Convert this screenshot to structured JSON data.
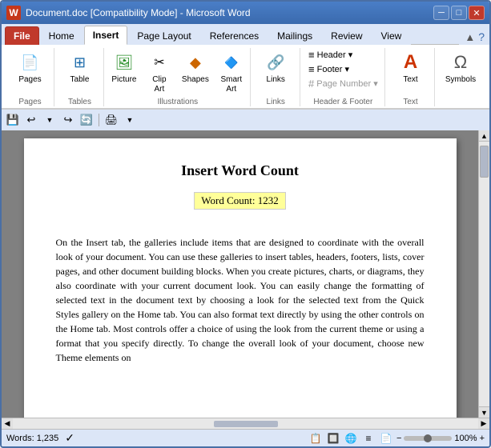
{
  "window": {
    "title": "Document.doc [Compatibility Mode] - Microsoft Word",
    "icon": "W"
  },
  "title_bar_controls": {
    "minimize": "─",
    "maximize": "□",
    "close": "✕"
  },
  "ribbon": {
    "tabs": [
      {
        "id": "file",
        "label": "File",
        "type": "file"
      },
      {
        "id": "home",
        "label": "Home",
        "type": "normal"
      },
      {
        "id": "insert",
        "label": "Insert",
        "type": "active"
      },
      {
        "id": "page_layout",
        "label": "Page Layout",
        "type": "normal"
      },
      {
        "id": "references",
        "label": "References",
        "type": "normal"
      },
      {
        "id": "mailings",
        "label": "Mailings",
        "type": "normal"
      },
      {
        "id": "review",
        "label": "Review",
        "type": "normal"
      },
      {
        "id": "view",
        "label": "View",
        "type": "normal"
      }
    ],
    "groups": {
      "pages": {
        "label": "Pages",
        "buttons": [
          {
            "id": "pages",
            "label": "Pages",
            "icon": "📄"
          }
        ]
      },
      "tables": {
        "label": "Tables",
        "buttons": [
          {
            "id": "table",
            "label": "Table",
            "icon": "⊞"
          }
        ]
      },
      "illustrations": {
        "label": "Illustrations",
        "buttons": [
          {
            "id": "picture",
            "label": "Picture",
            "icon": "🖼"
          },
          {
            "id": "clip_art",
            "label": "Clip\nArt",
            "icon": "✂"
          },
          {
            "id": "shapes",
            "label": "Shapes",
            "icon": "◆"
          }
        ]
      },
      "links": {
        "label": "Links",
        "buttons": [
          {
            "id": "links",
            "label": "Links",
            "icon": "🔗"
          }
        ]
      },
      "header_footer": {
        "label": "Header & Footer",
        "items": [
          {
            "id": "header",
            "label": "Header ▾"
          },
          {
            "id": "footer",
            "label": "Footer ▾"
          },
          {
            "id": "page_number",
            "label": "Page Number ▾",
            "disabled": true
          }
        ]
      },
      "text": {
        "label": "Text",
        "buttons": [
          {
            "id": "text",
            "label": "Text",
            "icon": "A"
          }
        ]
      },
      "symbols": {
        "label": "",
        "buttons": [
          {
            "id": "symbols",
            "label": "Symbols",
            "icon": "Ω"
          }
        ]
      }
    }
  },
  "quick_access": {
    "buttons": [
      "💾",
      "↩",
      "↪",
      "🔄",
      "🖨"
    ]
  },
  "document": {
    "title": "Insert Word Count",
    "word_count_label": "Word Count:",
    "word_count_value": "1232",
    "body_text": "On the Insert tab, the galleries include items that are designed to coordinate with the overall look of your document. You can use these galleries to insert tables, headers, footers, lists, cover pages, and other document building blocks. When you create pictures, charts, or diagrams, they also coordinate with your current document look. You can easily change the formatting of selected text in the document text by choosing a look for the selected text from the Quick Styles gallery on the Home tab. You can also format text directly by using the other controls on the Home tab. Most controls offer a choice of using the look from the current theme or using a format that you specify directly. To change the overall look of your document, choose new Theme elements on"
  },
  "status_bar": {
    "words_label": "Words: 1,235",
    "zoom_level": "100%"
  }
}
